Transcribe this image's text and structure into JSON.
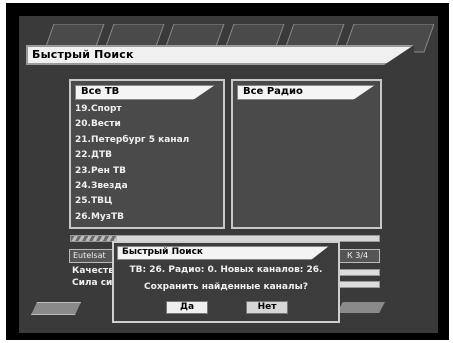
{
  "window": {
    "title": "Быстрый Поиск"
  },
  "tv_panel": {
    "header": "Все ТВ",
    "channels": [
      "19.Спорт",
      "20.Вести",
      "21.Петербург 5 канал",
      "22.ДТВ",
      "23.Рен ТВ",
      "24.Звезда",
      "25.ТВЦ",
      "26.МузТВ"
    ]
  },
  "radio_panel": {
    "header": "Все Радио",
    "channels": []
  },
  "status": {
    "satellite": "Eutelsat",
    "transponder": "К 3/4",
    "quality_label": "Качество",
    "strength_label": "Сила си",
    "scan_progress_fraction": 0.15
  },
  "dialog": {
    "title": "Быстрый Поиск",
    "info": "ТВ: 26. Радио: 0. Новых каналов: 26.",
    "question": "Сохранить найденные каналы?",
    "yes_label": "Да",
    "no_label": "Нет"
  }
}
